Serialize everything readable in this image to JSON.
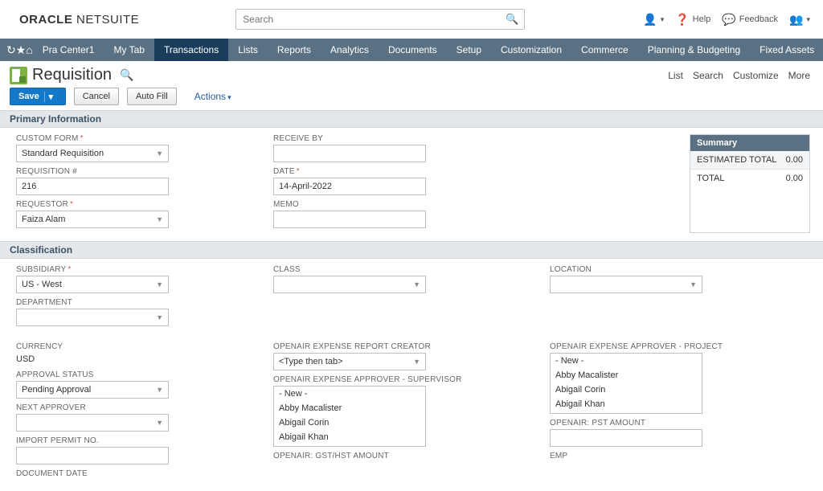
{
  "header": {
    "brand_prefix": "ORACLE",
    "brand_suffix": " NETSUITE",
    "search_placeholder": "Search",
    "help_label": "Help",
    "feedback_label": "Feedback"
  },
  "nav": {
    "items": [
      "Pra Center1",
      "My Tab",
      "Transactions",
      "Lists",
      "Reports",
      "Analytics",
      "Documents",
      "Setup",
      "Customization",
      "Commerce",
      "Planning & Budgeting",
      "Fixed Assets"
    ],
    "active_index": 2
  },
  "page": {
    "title": "Requisition",
    "head_links": [
      "List",
      "Search",
      "Customize",
      "More"
    ]
  },
  "actions": {
    "save": "Save",
    "cancel": "Cancel",
    "auto_fill": "Auto Fill",
    "actions_menu": "Actions"
  },
  "sections": {
    "primary_info": "Primary Information",
    "classification": "Classification"
  },
  "fields": {
    "custom_form": {
      "label": "CUSTOM FORM",
      "value": "Standard Requisition"
    },
    "requisition_no": {
      "label": "REQUISITION #",
      "value": "216"
    },
    "requestor": {
      "label": "REQUESTOR",
      "value": "Faiza Alam"
    },
    "receive_by": {
      "label": "RECEIVE BY",
      "value": ""
    },
    "date": {
      "label": "DATE",
      "value": "14-April-2022"
    },
    "memo": {
      "label": "MEMO",
      "value": ""
    },
    "subsidiary": {
      "label": "SUBSIDIARY",
      "value": "US - West"
    },
    "department": {
      "label": "DEPARTMENT",
      "value": ""
    },
    "class": {
      "label": "CLASS",
      "value": ""
    },
    "location": {
      "label": "LOCATION",
      "value": ""
    },
    "currency": {
      "label": "CURRENCY",
      "value": "USD"
    },
    "approval_status": {
      "label": "APPROVAL STATUS",
      "value": "Pending Approval"
    },
    "next_approver": {
      "label": "NEXT APPROVER",
      "value": ""
    },
    "import_permit_no": {
      "label": "IMPORT PERMIT NO.",
      "value": ""
    },
    "document_date": {
      "label": "DOCUMENT DATE",
      "value": ""
    },
    "oa_creator": {
      "label": "OPENAIR EXPENSE REPORT CREATOR",
      "value": "<Type then tab>"
    },
    "oa_supervisor": {
      "label": "OPENAIR EXPENSE APPROVER - SUPERVISOR",
      "options": [
        "- New -",
        "Abby Macalister",
        "Abigail Corin",
        "Abigail Khan"
      ]
    },
    "oa_gst": {
      "label": "OPENAIR: GST/HST AMOUNT"
    },
    "oa_project": {
      "label": "OPENAIR EXPENSE APPROVER - PROJECT",
      "options": [
        "- New -",
        "Abby Macalister",
        "Abigail Corin",
        "Abigail Khan"
      ]
    },
    "oa_pst": {
      "label": "OPENAIR: PST AMOUNT",
      "value": ""
    },
    "emp": {
      "label": "EMP"
    }
  },
  "summary": {
    "title": "Summary",
    "rows": [
      {
        "label": "ESTIMATED TOTAL",
        "value": "0.00"
      },
      {
        "label": "TOTAL",
        "value": "0.00"
      }
    ]
  }
}
